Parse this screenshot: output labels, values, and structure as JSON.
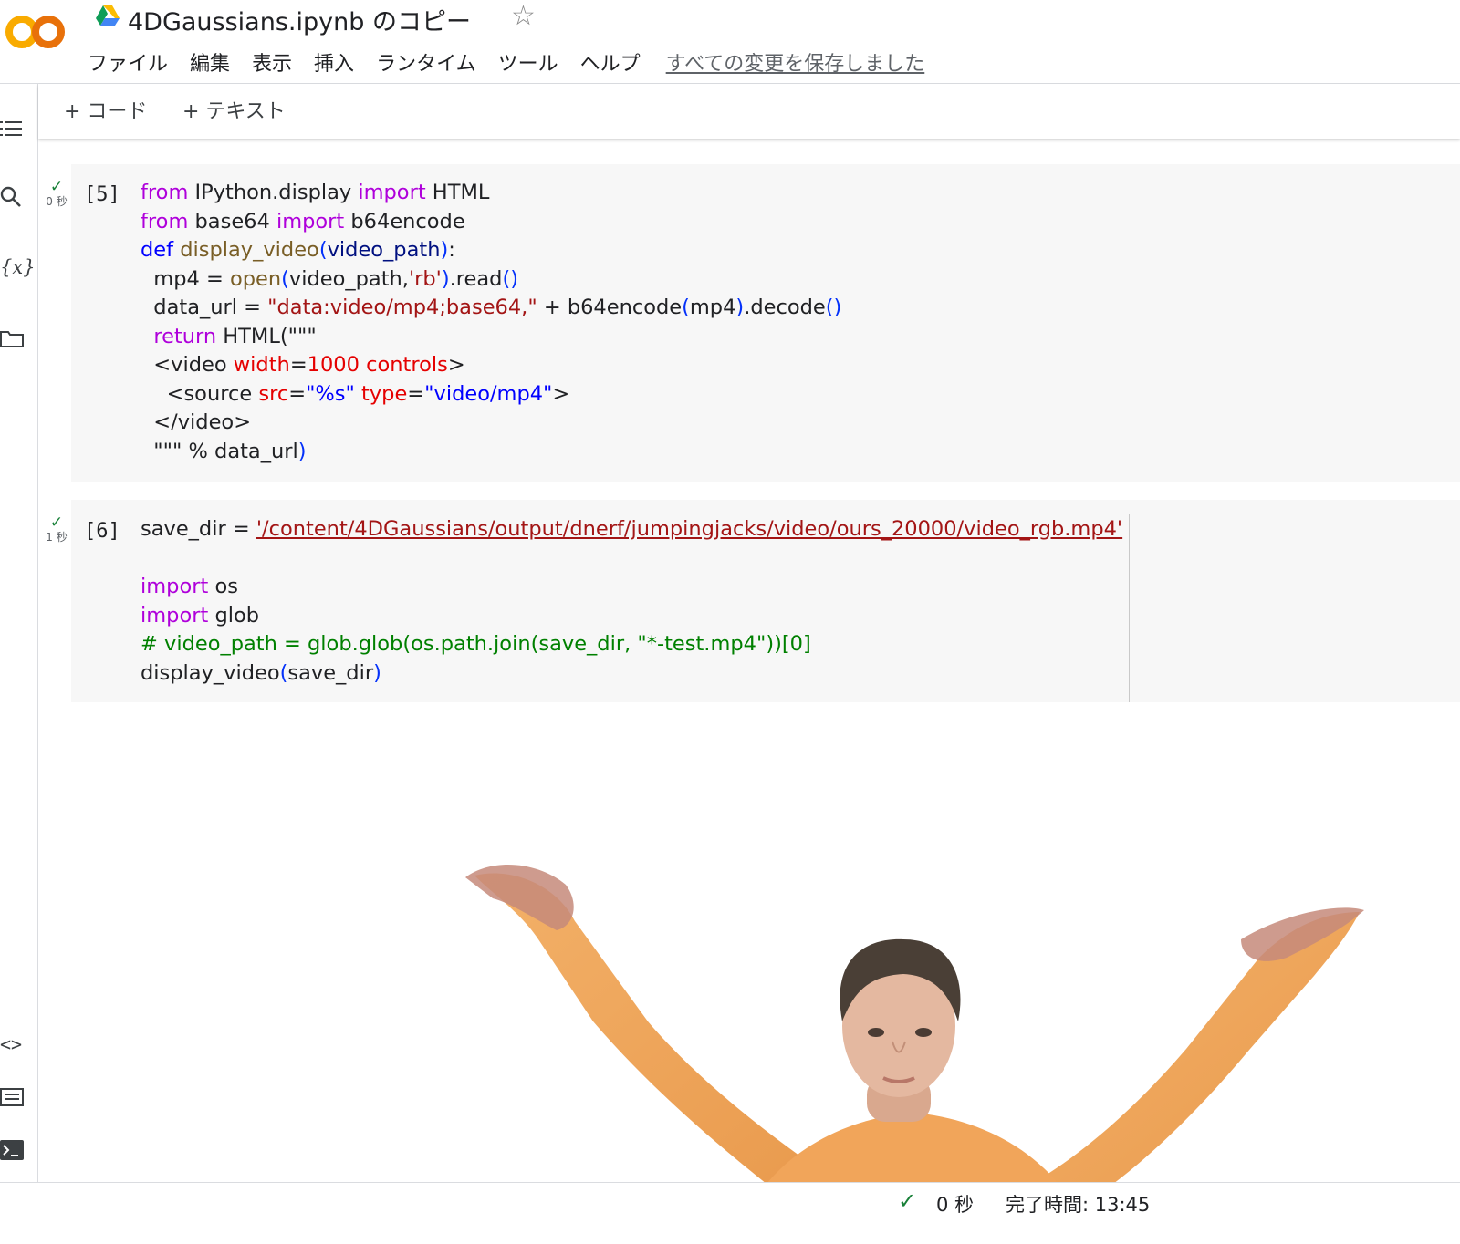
{
  "app": {
    "logo_text": "CO",
    "accent_color": "#f9ab00",
    "accent_color_2": "#e8710a"
  },
  "header": {
    "title": "4DGaussians.ipynb のコピー",
    "menu": [
      "ファイル",
      "編集",
      "表示",
      "挿入",
      "ランタイム",
      "ツール",
      "ヘルプ"
    ],
    "saved_status": "すべての変更を保存しました"
  },
  "toolbar": {
    "add_code": "+ コード",
    "add_text": "+ テキスト"
  },
  "sidebar": {
    "icons": [
      "table-of-contents-icon",
      "search-icon",
      "variables-icon",
      "folder-icon",
      "code-snippets-icon",
      "command-palette-icon",
      "terminal-icon"
    ],
    "variables_label": "{x}"
  },
  "cells": [
    {
      "execution_count": "[5]",
      "status": "✓",
      "time": "0 秒",
      "lines": {
        "l1": {
          "from": "from",
          "mod": " IPython.display ",
          "import": "import",
          "name": " HTML"
        },
        "l2": {
          "from": "from",
          "mod": " base64 ",
          "import": "import",
          "name": " b64encode"
        },
        "l3": {
          "def": "def",
          "fn": " display_video",
          "open": "(",
          "param": "video_path",
          "close": ")",
          "colon": ":"
        },
        "l4": {
          "indent": "  mp4 = ",
          "fn": "open",
          "open": "(",
          "arg": "video_path,",
          "str": "'rb'",
          "close": ")",
          "mid": ".read",
          "call": "()"
        },
        "l5": {
          "indent": "  data_url = ",
          "str": "\"data:video/mp4;base64,\"",
          "plus": " + b64encode",
          "open": "(",
          "arg": "mp4",
          "close": ")",
          "mid": ".decode",
          "call": "()"
        },
        "l6": {
          "return": "return",
          "rest": " HTML(\"\"\""
        },
        "l7": {
          "indent": "  <video ",
          "attr1": "width",
          "eq": "=",
          "num": "1000",
          "sp": " ",
          "attr2": "controls",
          "end": ">"
        },
        "l8": {
          "indent": "    <source ",
          "attr1": "src",
          "eq1": "=",
          "val1": "\"%s\"",
          "sp": " ",
          "attr2": "type",
          "eq2": "=",
          "val2": "\"video/mp4\"",
          "end": ">"
        },
        "l9": {
          "text": "  </video>"
        },
        "l10": {
          "text": "  \"\"\" % data_url",
          "close": ")"
        }
      }
    },
    {
      "execution_count": "[6]",
      "status": "✓",
      "time": "1 秒",
      "lines": {
        "l1": {
          "pre": "save_dir = ",
          "path": "'/content/4DGaussians/output/dnerf/jumpingjacks/video/ours_20000/video_rgb.mp4'"
        },
        "l2": {
          "import": "import",
          "name": " os"
        },
        "l3": {
          "import": "import",
          "name": " glob"
        },
        "l4": {
          "comment": "# video_path = glob.glob(os.path.join(save_dir, \"*-test.mp4\"))[0]"
        },
        "l5": {
          "fn": "display_video",
          "open": "(",
          "arg": "save_dir",
          "close": ")"
        }
      }
    }
  ],
  "status_bar": {
    "check": "✓",
    "elapsed": "0 秒",
    "completed": "完了時間: 13:45"
  }
}
